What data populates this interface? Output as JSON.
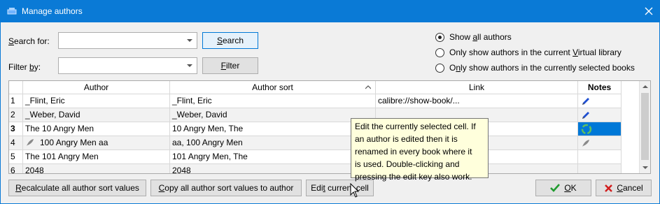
{
  "window": {
    "title": "Manage authors"
  },
  "search": {
    "label_pre": "",
    "label_u": "S",
    "label_post": "earch for:",
    "value": "",
    "button_pre": "",
    "button_u": "S",
    "button_post": "earch"
  },
  "filter": {
    "label_pre": "Filter ",
    "label_u": "b",
    "label_post": "y:",
    "value": "",
    "button_pre": "",
    "button_u": "F",
    "button_post": "ilter"
  },
  "radios": [
    {
      "pre": "Show ",
      "u": "a",
      "post": "ll authors",
      "checked": true
    },
    {
      "pre": "Only show authors in the current ",
      "u": "V",
      "post": "irtual library",
      "checked": false
    },
    {
      "pre": "O",
      "u": "n",
      "post": "ly show authors in the currently selected books",
      "checked": false
    }
  ],
  "table": {
    "headers": {
      "author": "Author",
      "sort": "Author sort",
      "link": "Link",
      "notes": "Notes"
    },
    "rows": [
      {
        "num": "1",
        "author": "_Flint, Eric",
        "sort": "_Flint, Eric",
        "link": "calibre://show-book/...",
        "note": "pencil"
      },
      {
        "num": "2",
        "author": "_Weber, David",
        "sort": "_Weber, David",
        "link": "",
        "note": "pencil"
      },
      {
        "num": "3",
        "author": "The 10 Angry Men",
        "sort": "10 Angry Men, The",
        "link": "",
        "note": "recycle"
      },
      {
        "num": "4",
        "author": "100 Angry Men aa",
        "sort": "aa, 100 Angry Men",
        "link": "",
        "note": "quill"
      },
      {
        "num": "5",
        "author": "The 101 Angry Men",
        "sort": "101 Angry Men, The",
        "link": "",
        "note": ""
      },
      {
        "num": "6",
        "author": "2048",
        "sort": "2048",
        "link": "",
        "note": ""
      }
    ]
  },
  "tooltip": {
    "lines": [
      "Edit the currently selected cell. If",
      "an author is edited then it is",
      "renamed in every book where it",
      "is used. Double-clicking and",
      "pressing the edit key also work."
    ]
  },
  "footer": {
    "recalc_pre": "",
    "recalc_u": "R",
    "recalc_post": "ecalculate all author sort values",
    "copy_pre": "",
    "copy_u": "C",
    "copy_post": "opy all author sort values to author",
    "edit_pre": "Edi",
    "edit_u": "t",
    "edit_post": " current cell",
    "ok_pre": "",
    "ok_u": "O",
    "ok_post": "K",
    "cancel_pre": "",
    "cancel_u": "C",
    "cancel_post": "ancel"
  },
  "colors": {
    "titlebar": "#0a7ad6",
    "selection": "#0078d7",
    "tooltip_bg": "#ffffdc",
    "pencil": "#1f4fd1",
    "ok_check": "#1f9b2e",
    "cancel_x": "#d11c1c"
  }
}
